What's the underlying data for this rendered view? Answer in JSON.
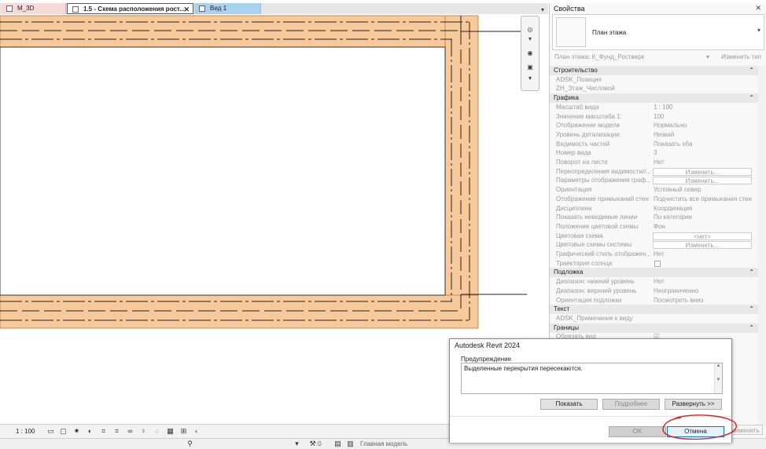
{
  "tabs": [
    {
      "label": "M_3D",
      "active": false,
      "color": "#f7d9d9"
    },
    {
      "label": "1.5 - Схема расположения рост...",
      "active": true
    },
    {
      "label": "Вид 1",
      "active": false,
      "color": "#a9d2ee"
    }
  ],
  "canvas": {
    "wall_fill": "#f8c99a",
    "wall_stroke": "#222222"
  },
  "statusbar": {
    "scale": "1 : 100",
    "workset_count": ":0",
    "model": "Главная модель"
  },
  "properties": {
    "title": "Свойства",
    "type_name": "План этажа",
    "selector_value": "План этажа: К_Фунд_Ростверк",
    "edit_type": "Изменить тип",
    "apply": "Применить",
    "rows": [
      {
        "kind": "section",
        "name": "Строительство"
      },
      {
        "kind": "param",
        "name": "ADSK_Позиция",
        "value": ""
      },
      {
        "kind": "param",
        "name": "ZH_Этаж_Числовой",
        "value": ""
      },
      {
        "kind": "section",
        "name": "Графика"
      },
      {
        "kind": "param",
        "name": "Масштаб вида",
        "value": "1 : 100"
      },
      {
        "kind": "param",
        "name": "Значение масштаба    1:",
        "value": "100"
      },
      {
        "kind": "param",
        "name": "Отображение модели",
        "value": "Нормально"
      },
      {
        "kind": "param",
        "name": "Уровень детализации",
        "value": "Низкий"
      },
      {
        "kind": "param",
        "name": "Видимость частей",
        "value": "Показать оба"
      },
      {
        "kind": "param",
        "name": "Номер вида",
        "value": "3"
      },
      {
        "kind": "param",
        "name": "Поворот на листе",
        "value": "Нет"
      },
      {
        "kind": "button",
        "name": "Переопределения видимости/г...",
        "value": "Изменить..."
      },
      {
        "kind": "button",
        "name": "Параметры отображения граф...",
        "value": "Изменить..."
      },
      {
        "kind": "param",
        "name": "Ориентация",
        "value": "Условный север"
      },
      {
        "kind": "param",
        "name": "Отображение примыканий стен",
        "value": "Подчистить все примыкания стен"
      },
      {
        "kind": "param",
        "name": "Дисциплина",
        "value": "Координация"
      },
      {
        "kind": "param",
        "name": "Показать невидимые линии",
        "value": "По категории"
      },
      {
        "kind": "param",
        "name": "Положение цветовой схемы",
        "value": "Фон"
      },
      {
        "kind": "button",
        "name": "Цветовая схема",
        "value": "<нет>"
      },
      {
        "kind": "button",
        "name": "Цветовые схемы системы",
        "value": "Изменить..."
      },
      {
        "kind": "param",
        "name": "Графический стиль отображен...",
        "value": "Нет"
      },
      {
        "kind": "check",
        "name": "Траектория солнца",
        "value": ""
      },
      {
        "kind": "section",
        "name": "Подложка"
      },
      {
        "kind": "param",
        "name": "Диапазон: нижний уровень",
        "value": "Нет"
      },
      {
        "kind": "param",
        "name": "Диапазон: верхний уровень",
        "value": "Неограниченно"
      },
      {
        "kind": "param",
        "name": "Ориентация подложки",
        "value": "Посмотреть вниз"
      },
      {
        "kind": "section",
        "name": "Текст"
      },
      {
        "kind": "param",
        "name": "ADSK_Примечание к виду",
        "value": ""
      },
      {
        "kind": "section",
        "name": "Границы"
      },
      {
        "kind": "param",
        "name": "Обрезать вид",
        "value": "☑"
      }
    ]
  },
  "dialog": {
    "title": "Autodesk Revit 2024",
    "warning_label": "Предупреждение",
    "warning_text": "Выделенные перекрытия пересекаются.",
    "show": "Показать",
    "more": "Подробнее",
    "expand": "Развернуть >>",
    "ok": "OK",
    "cancel": "Отмена",
    "highlight_color": "#e0201b"
  }
}
